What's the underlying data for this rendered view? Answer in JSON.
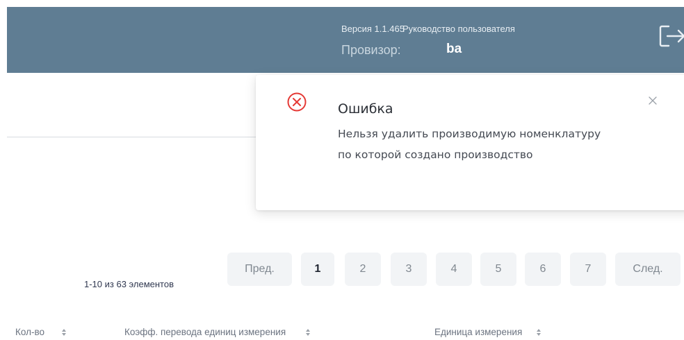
{
  "header": {
    "version": "Версия 1.1.465",
    "guide_link": "Руководство пользователя",
    "role_label": "Провизор:",
    "user_name": "ba"
  },
  "toast": {
    "title": "Ошибка",
    "message": "Нельзя удалить производимую номенклатуру по которой создано производство",
    "icon": "error-circle-icon"
  },
  "pagination": {
    "info": "1-10 из 63 элементов",
    "prev_label": "Пред.",
    "pages": [
      "1",
      "2",
      "3",
      "4",
      "5",
      "6",
      "7"
    ],
    "current_page": "1",
    "next_label": "След."
  },
  "table": {
    "columns": [
      "Кол-во",
      "Коэфф. перевода единиц измерения",
      "Единица измерения"
    ]
  },
  "colors": {
    "header_bg": "#5f7d93",
    "error": "#e53935"
  }
}
